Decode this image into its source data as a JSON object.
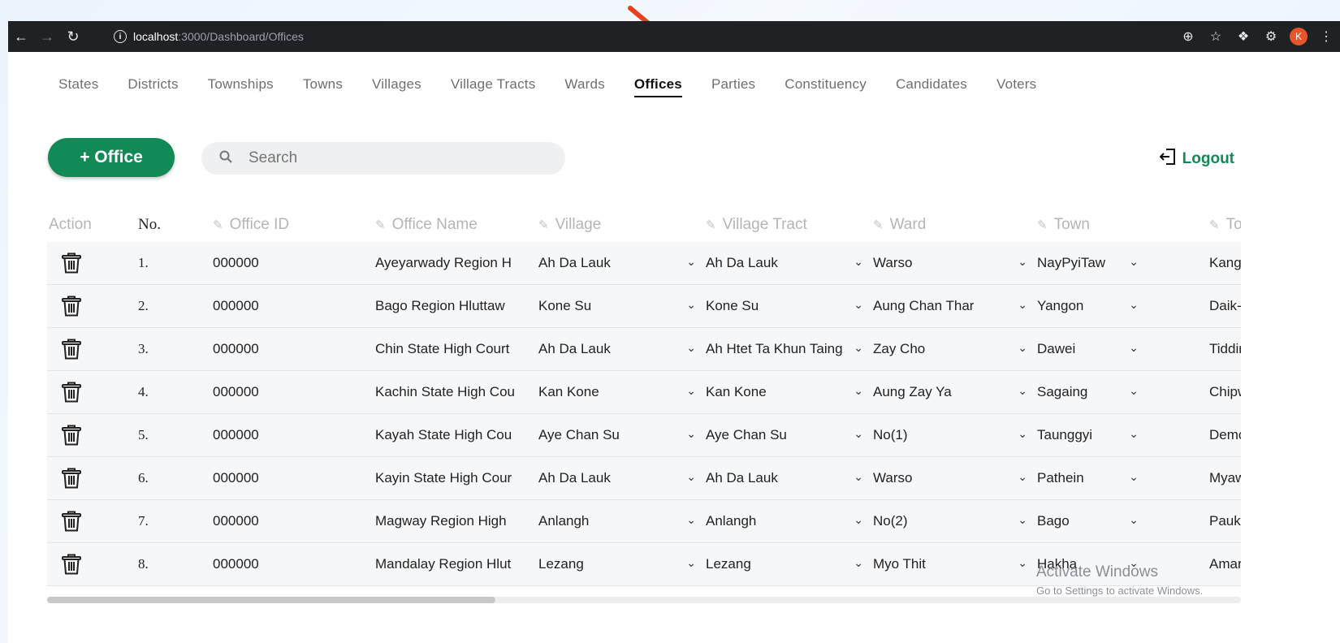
{
  "browser": {
    "url_host": "localhost",
    "url_path": ":3000/Dashboard/Offices",
    "avatar_letter": "K"
  },
  "nav_tabs": [
    {
      "label": "States"
    },
    {
      "label": "Districts"
    },
    {
      "label": "Townships"
    },
    {
      "label": "Towns"
    },
    {
      "label": "Villages"
    },
    {
      "label": "Village Tracts"
    },
    {
      "label": "Wards"
    },
    {
      "label": "Offices",
      "active": true
    },
    {
      "label": "Parties"
    },
    {
      "label": "Constituency"
    },
    {
      "label": "Candidates"
    },
    {
      "label": "Voters"
    }
  ],
  "toolbar": {
    "add_label": "+ Office",
    "search_placeholder": "Search",
    "logout_label": "Logout"
  },
  "table": {
    "headers": {
      "action": "Action",
      "no": "No.",
      "office_id": "Office ID",
      "office_name": "Office Name",
      "village": "Village",
      "village_tract": "Village Tract",
      "ward": "Ward",
      "town": "Town",
      "township": "Tov"
    },
    "rows": [
      {
        "no": "1.",
        "office_id": "000000",
        "office_name": "Ayeyarwady Region H",
        "village": "Ah Da Lauk",
        "village_tract": "Ah Da Lauk",
        "ward": "Warso",
        "town": "NayPyiTaw",
        "township": "Kangy"
      },
      {
        "no": "2.",
        "office_id": "000000",
        "office_name": "Bago Region Hluttaw",
        "village": "Kone Su",
        "village_tract": "Kone Su",
        "ward": "Aung Chan Thar",
        "town": "Yangon",
        "township": "Daik-U"
      },
      {
        "no": "3.",
        "office_id": "000000",
        "office_name": "Chin State High Court",
        "village": "Ah Da Lauk",
        "village_tract": "Ah Htet Ta Khun Taing",
        "ward": "Zay Cho",
        "town": "Dawei",
        "township": "Tiddir"
      },
      {
        "no": "4.",
        "office_id": "000000",
        "office_name": "Kachin State High Cou",
        "village": "Kan Kone",
        "village_tract": "Kan Kone",
        "ward": "Aung Zay Ya",
        "town": "Sagaing",
        "township": "Chipw"
      },
      {
        "no": "5.",
        "office_id": "000000",
        "office_name": "Kayah State High Cou",
        "village": "Aye Chan Su",
        "village_tract": "Aye Chan Su",
        "ward": "No(1)",
        "town": "Taunggyi",
        "township": "Demo"
      },
      {
        "no": "6.",
        "office_id": "000000",
        "office_name": "Kayin State High Cour",
        "village": "Ah Da Lauk",
        "village_tract": "Ah Da Lauk",
        "ward": "Warso",
        "town": "Pathein",
        "township": "Myaw"
      },
      {
        "no": "7.",
        "office_id": "000000",
        "office_name": "Magway Region High",
        "village": "Anlangh",
        "village_tract": "Anlangh",
        "ward": "No(2)",
        "town": "Bago",
        "township": "Pauk"
      },
      {
        "no": "8.",
        "office_id": "000000",
        "office_name": "Mandalay Region Hlut",
        "village": "Lezang",
        "village_tract": "Lezang",
        "ward": "Myo Thit",
        "town": "Hakha",
        "township": "Amara"
      }
    ]
  },
  "watermark": {
    "line1": "Activate Windows",
    "line2": "Go to Settings to activate Windows."
  },
  "colors": {
    "accent": "#118a55",
    "arrow": "#e8401c",
    "browser_bar": "#202124"
  }
}
